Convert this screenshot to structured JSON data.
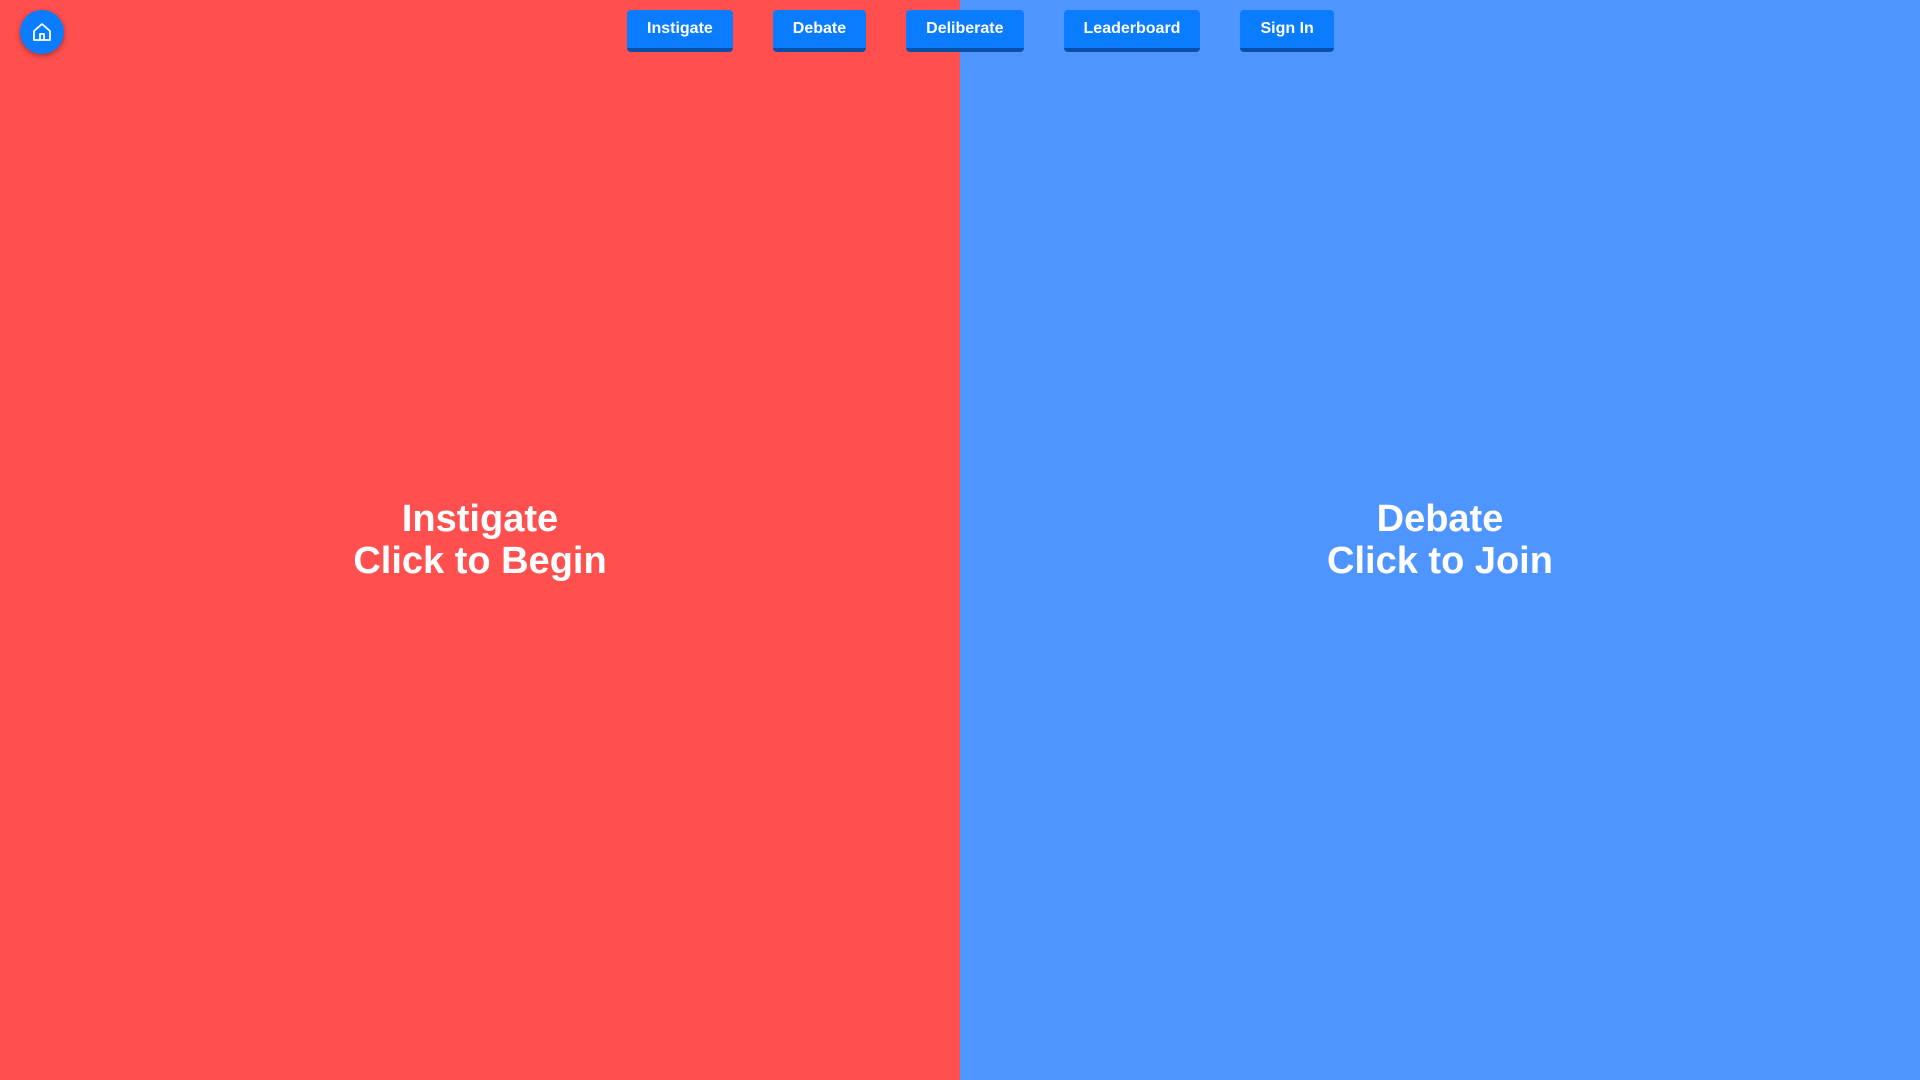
{
  "home": {
    "icon": "home-icon"
  },
  "nav": {
    "items": [
      {
        "label": "Instigate"
      },
      {
        "label": "Debate"
      },
      {
        "label": "Deliberate"
      },
      {
        "label": "Leaderboard"
      },
      {
        "label": "Sign In"
      }
    ]
  },
  "panels": {
    "left": {
      "title": "Instigate",
      "action": "Click to Begin",
      "color": "#ff4f4f"
    },
    "right": {
      "title": "Debate",
      "action": "Click to Join",
      "color": "#4f95ff"
    }
  },
  "colors": {
    "accent": "#0a7cff",
    "text": "#ffffff"
  }
}
